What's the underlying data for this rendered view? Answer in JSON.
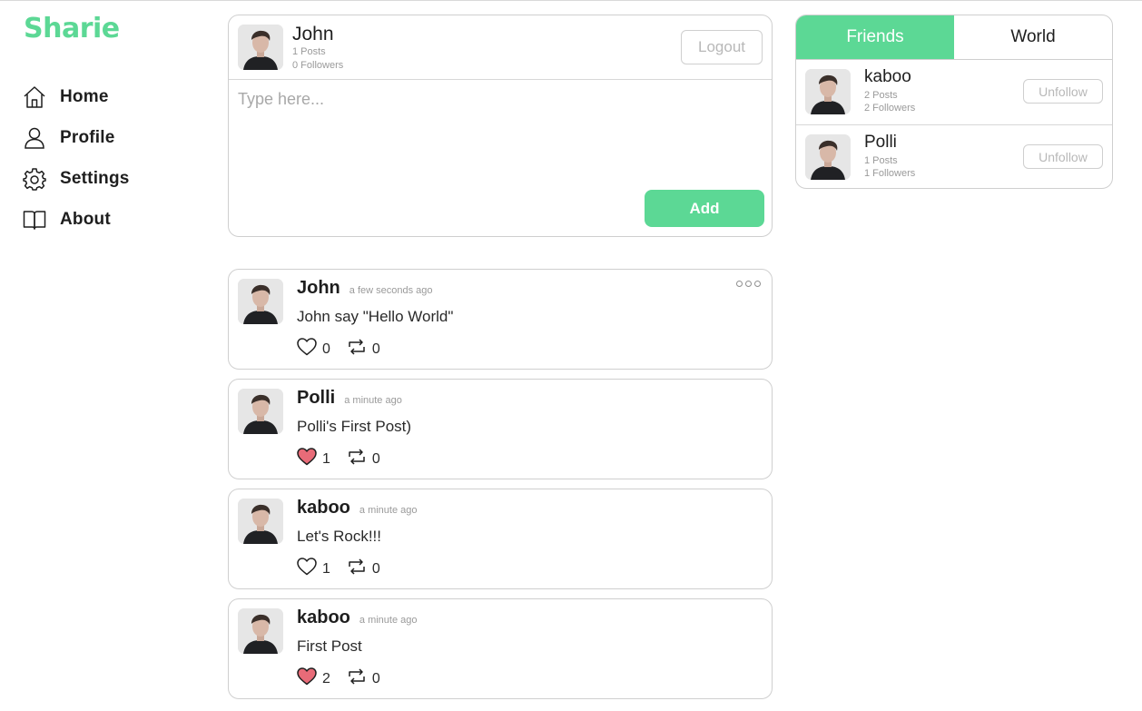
{
  "app": {
    "logo": "Sharie",
    "accent": "#5cd895",
    "like_color": "#e86b78"
  },
  "sidebar": {
    "items": [
      {
        "label": "Home",
        "icon": "home-icon"
      },
      {
        "label": "Profile",
        "icon": "user-icon"
      },
      {
        "label": "Settings",
        "icon": "gear-icon"
      },
      {
        "label": "About",
        "icon": "book-icon"
      }
    ]
  },
  "composer": {
    "user_name": "John",
    "posts": "1 Posts",
    "followers": "0 Followers",
    "logout_label": "Logout",
    "placeholder": "Type here...",
    "add_label": "Add"
  },
  "posts": [
    {
      "author": "John",
      "time": "a few seconds ago",
      "text": "John say \"Hello World\"",
      "likes": "0",
      "liked": false,
      "reposts": "0",
      "has_menu": true
    },
    {
      "author": "Polli",
      "time": "a minute ago",
      "text": "Polli's First Post)",
      "likes": "1",
      "liked": true,
      "reposts": "0",
      "has_menu": false
    },
    {
      "author": "kaboo",
      "time": "a minute ago",
      "text": "Let's Rock!!!",
      "likes": "1",
      "liked": false,
      "reposts": "0",
      "has_menu": false
    },
    {
      "author": "kaboo",
      "time": "a minute ago",
      "text": "First Post",
      "likes": "2",
      "liked": true,
      "reposts": "0",
      "has_menu": false
    }
  ],
  "friends_panel": {
    "tabs": [
      {
        "label": "Friends",
        "active": true
      },
      {
        "label": "World",
        "active": false
      }
    ],
    "friends": [
      {
        "name": "kaboo",
        "posts": "2 Posts",
        "followers": "2 Followers",
        "action": "Unfollow"
      },
      {
        "name": "Polli",
        "posts": "1 Posts",
        "followers": "1 Followers",
        "action": "Unfollow"
      }
    ]
  }
}
